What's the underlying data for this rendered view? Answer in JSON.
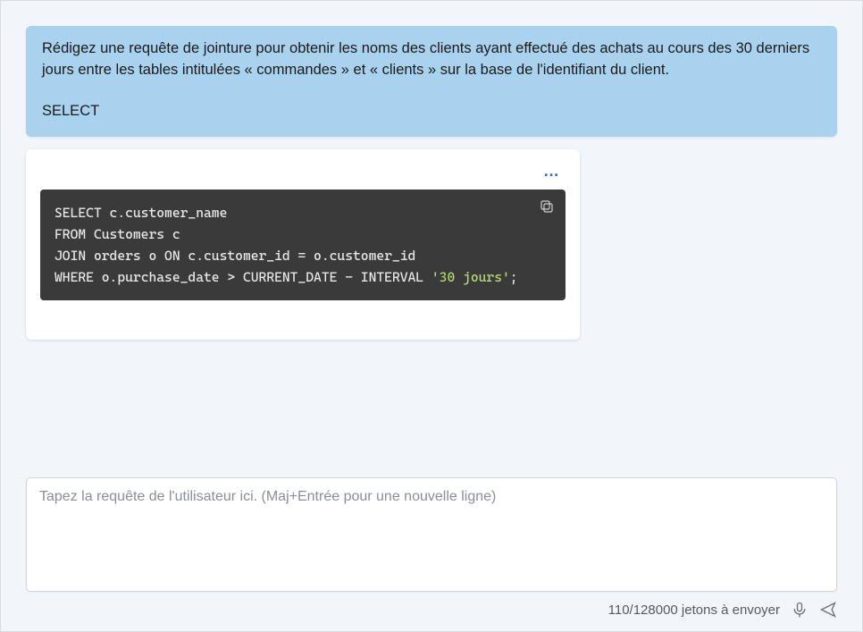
{
  "user_message": {
    "prompt": "Rédigez une requête de jointure pour obtenir les noms des clients ayant effectué des achats au cours des 30 derniers jours entre les tables intitulées « commandes » et « clients » sur la base de l'identifiant du client.",
    "trailing_keyword": "SELECT"
  },
  "assistant_message": {
    "menu_label": "…",
    "code": {
      "line1_a": "SELECT",
      "line1_b": " c.customer_name",
      "line2_a": "FROM",
      "line2_b": " Customers c",
      "line3_a": "JOIN",
      "line3_b": " orders o ",
      "line3_c": "ON",
      "line3_d": " c.customer_id = o.customer_id",
      "line4_a": "WHERE",
      "line4_b": " o.purchase_date > CURRENT_DATE - INTERVAL ",
      "line4_str": "'30 jours'",
      "line4_end": ";"
    }
  },
  "input": {
    "placeholder": "Tapez la requête de l'utilisateur ici. (Maj+Entrée pour une nouvelle ligne)"
  },
  "footer": {
    "token_text": "110/128000 jetons à envoyer"
  }
}
